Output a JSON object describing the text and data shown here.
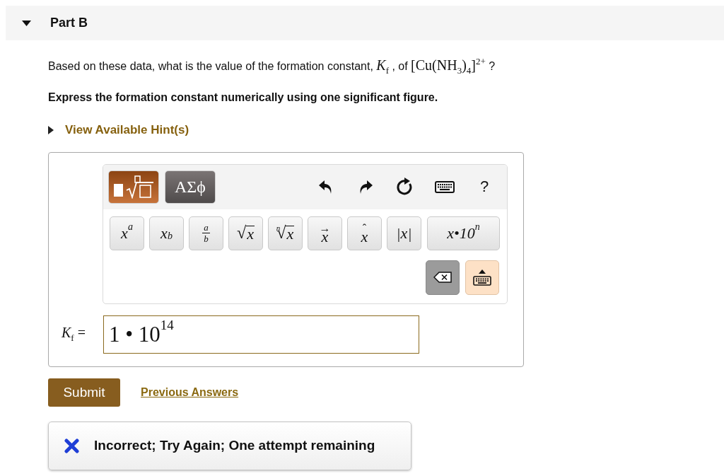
{
  "part": {
    "title": "Part B",
    "expanded": true
  },
  "question": [
    {
      "kind": "text",
      "text": "Based on these data, what is the value of the formation constant, "
    },
    {
      "kind": "math",
      "text": "*K*$_{f}$"
    },
    {
      "kind": "text",
      "text": " , of "
    },
    {
      "kind": "math",
      "text": "[Cu(NH$_{3}$)$_{4}$]$^{2+}$"
    },
    {
      "kind": "text",
      "text": " ?"
    }
  ],
  "instruction": "Express the formation constant numerically using one significant figure.",
  "hint": {
    "label": "View Available Hint(s)",
    "expanded": false
  },
  "editor": {
    "palettes": [
      {
        "kind": "templates",
        "selected": true
      },
      {
        "kind": "greek",
        "label": "ΑΣϕ",
        "selected": false
      }
    ],
    "tools": [
      {
        "kind": "undo"
      },
      {
        "kind": "redo"
      },
      {
        "kind": "reset"
      },
      {
        "kind": "keyboard"
      },
      {
        "kind": "help",
        "label": "?"
      }
    ],
    "templates": [
      {
        "kind": "script",
        "text": "x$^{a}$"
      },
      {
        "kind": "script",
        "text": "x$_{b}$"
      },
      {
        "kind": "frac",
        "top": "a",
        "bottom": "b"
      },
      {
        "kind": "root",
        "radical": "√",
        "base": "x"
      },
      {
        "kind": "root",
        "index": "n",
        "radical": "√",
        "base": "x"
      },
      {
        "kind": "accent",
        "accent": "→",
        "base": "x"
      },
      {
        "kind": "accent",
        "accent": "ˆ",
        "base": "x"
      },
      {
        "kind": "script",
        "text": "|x|"
      },
      {
        "kind": "sci",
        "text": "x•10$^{n}$"
      }
    ],
    "keys": [
      {
        "kind": "backspace"
      },
      {
        "kind": "keyboard_toggle"
      }
    ]
  },
  "answer": {
    "label": "*K*$_{f}$ =",
    "value": "1 • 10$^{14}$"
  },
  "submit": "Submit",
  "previous_answers": "Previous Answers",
  "feedback": {
    "kind": "incorrect",
    "text": "Incorrect; Try Again; One attempt remaining"
  }
}
